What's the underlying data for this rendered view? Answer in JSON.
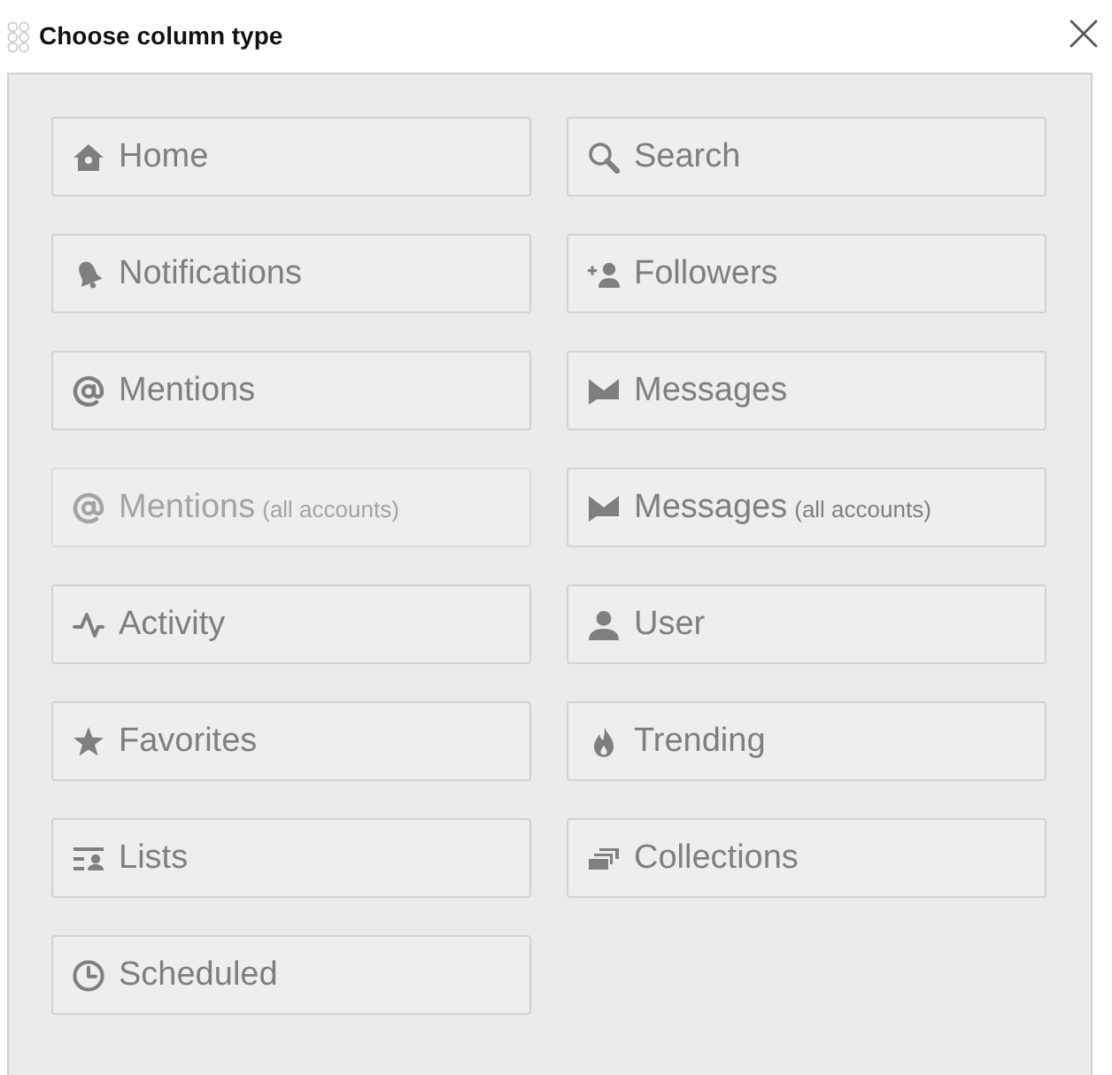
{
  "dialog": {
    "title": "Choose column type"
  },
  "column_types": [
    {
      "kind": "home",
      "label": "Home",
      "disabled": false
    },
    {
      "kind": "search",
      "label": "Search",
      "disabled": false
    },
    {
      "kind": "notifications",
      "label": "Notifications",
      "disabled": false
    },
    {
      "kind": "followers",
      "label": "Followers",
      "disabled": false
    },
    {
      "kind": "mentions",
      "label": "Mentions",
      "disabled": false
    },
    {
      "kind": "messages",
      "label": "Messages",
      "disabled": false
    },
    {
      "kind": "mentions",
      "label": "Mentions",
      "sublabel": "(all accounts)",
      "disabled": true
    },
    {
      "kind": "messages",
      "label": "Messages",
      "sublabel": "(all accounts)",
      "disabled": false
    },
    {
      "kind": "activity",
      "label": "Activity",
      "disabled": false
    },
    {
      "kind": "user",
      "label": "User",
      "disabled": false
    },
    {
      "kind": "favorites",
      "label": "Favorites",
      "disabled": false
    },
    {
      "kind": "trending",
      "label": "Trending",
      "disabled": false
    },
    {
      "kind": "lists",
      "label": "Lists",
      "disabled": false
    },
    {
      "kind": "collections",
      "label": "Collections",
      "disabled": false
    },
    {
      "kind": "scheduled",
      "label": "Scheduled",
      "disabled": false
    }
  ]
}
